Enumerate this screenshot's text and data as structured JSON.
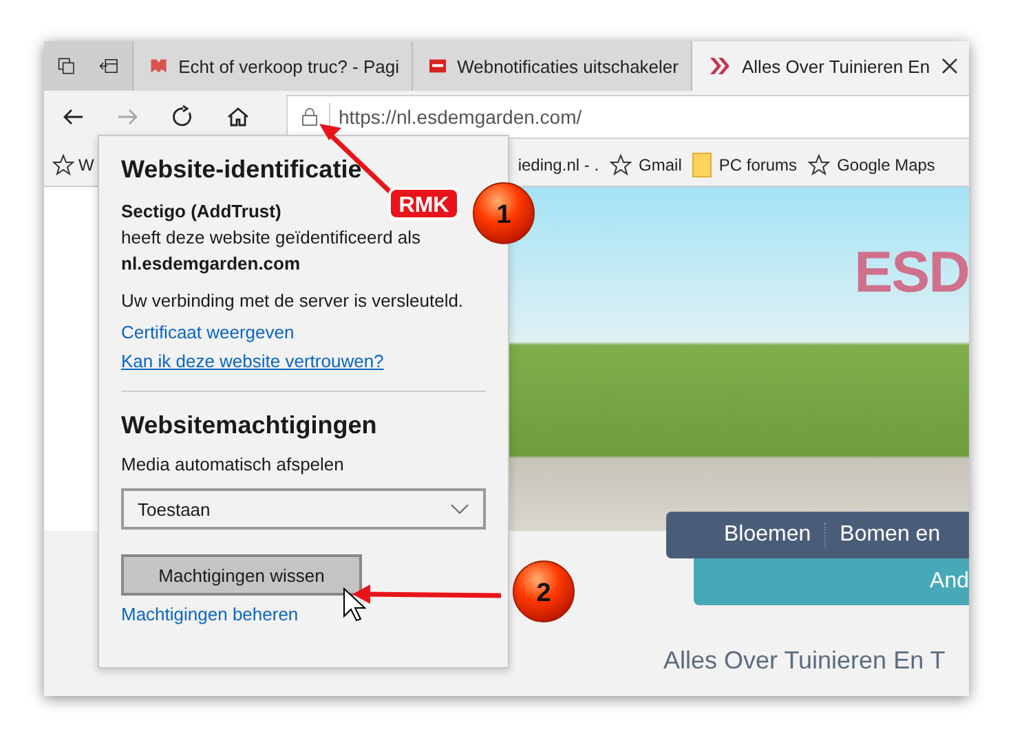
{
  "tabs": [
    {
      "title": "Echt of verkoop truc? - Pagi",
      "kind": "flag",
      "selected": false
    },
    {
      "title": "Webnotificaties uitschakeler",
      "kind": "banner",
      "selected": false
    },
    {
      "title": "Alles Over Tuinieren En",
      "kind": "chevrons",
      "selected": true
    }
  ],
  "nav_buttons": [
    {
      "kind": "back",
      "disabled": false
    },
    {
      "kind": "forward",
      "disabled": true
    },
    {
      "kind": "refresh",
      "disabled": false
    },
    {
      "kind": "home",
      "disabled": false
    }
  ],
  "address_bar": {
    "url": "https://nl.esdemgarden.com/"
  },
  "bookmarks": [
    {
      "kind": "star",
      "label": "W"
    },
    {
      "kind": "none",
      "label": "ieding.nl - ."
    },
    {
      "kind": "star",
      "label": "Gmail"
    },
    {
      "kind": "folder",
      "label": "PC forums"
    },
    {
      "kind": "star",
      "label": "Google Maps"
    }
  ],
  "website": {
    "logo": "ESD",
    "nav": [
      "Bloemen",
      "Bomen en"
    ],
    "bar_text": "And",
    "heading": "Alles Over Tuinieren En T"
  },
  "popup": {
    "title": "Website-identificatie",
    "issuer": "Sectigo (AddTrust)",
    "identified": "heeft deze website geïdentificeerd als",
    "domain": "nl.esdemgarden.com",
    "connection": "Uw verbinding met de server is versleuteld.",
    "links": [
      {
        "label": "Certificaat weergeven",
        "underlined": false
      },
      {
        "label": "Kan ik deze website vertrouwen?",
        "underlined": true
      }
    ],
    "permissions_title": "Websitemachtigingen",
    "setting_label": "Media automatisch afspelen",
    "setting_value": "Toestaan",
    "clear_button": "Machtigingen wissen",
    "manage_link": "Machtigingen beheren"
  },
  "annotations": {
    "label": "RMK",
    "markers": [
      "1",
      "2"
    ]
  }
}
